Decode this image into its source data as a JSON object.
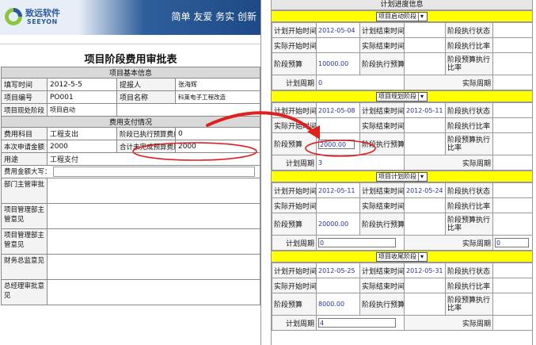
{
  "brand": {
    "name_cn": "致远软件",
    "name_en": "SEEYON",
    "slogan": "简单 友爱 务实 创新"
  },
  "form": {
    "title": "项目阶段费用审批表",
    "section_basic": "项目基本信息",
    "fill_time_label": "填写时间",
    "fill_time": "2012-5-5",
    "reporter_label": "提报人",
    "reporter": "张海辉",
    "project_no_label": "项目编号",
    "project_no": "PO001",
    "project_name_label": "项目名称",
    "project_name": "科莱电子工程改造",
    "current_stage_label": "项目现处阶段",
    "current_stage": "项目启动",
    "section_payment": "费用支付情况",
    "fee_subject_label": "费用科目",
    "fee_subject": "工程支出",
    "stage_executed_label": "阶段已执行预算费用",
    "stage_executed": "0",
    "apply_amount_label": "本次申请金额",
    "apply_amount": "2000",
    "total_unfinished_label": "合计未完成预算费用",
    "total_unfinished": "2000",
    "usage_label": "用途",
    "usage": "工程支付",
    "amount_caps_label": "费用金额大写：",
    "dept_opinion_label": "部门主管审批",
    "pm_opinion1_label": "项目管理部主管意见",
    "pm_opinion2_label": "项目管理部主管意见",
    "finance_opinion_label": "财务总监意见",
    "gm_opinion_label": "总经理审批意见"
  },
  "progress": {
    "title": "计划进度信息",
    "labels": {
      "plan_start": "计划开始时间",
      "plan_end": "计划结束时间",
      "stage_status": "阶段执行状态",
      "actual_start": "实际开始时间",
      "actual_end": "实际结束时间",
      "exec_rate": "阶段执行比率",
      "stage_budget": "阶段预算",
      "stage_exec_budget": "阶段执行预算",
      "budget_rate": "阶段预算执行比率",
      "plan_cycle": "计划周期",
      "actual_cycle": "实际周期"
    },
    "phases": [
      {
        "name": "项目启动阶段",
        "plan_start": "2012-05-04",
        "plan_end": "",
        "budget": "10000.00",
        "plan_cycle": "0"
      },
      {
        "name": "项目规划阶段",
        "plan_start": "2012-05-08",
        "plan_end": "2012-05-11",
        "budget": "2000.00",
        "plan_cycle": "3"
      },
      {
        "name": "项目计划阶段",
        "plan_start": "2012-05-11",
        "plan_end": "2012-05-24",
        "budget": "20000.00",
        "plan_cycle": "0",
        "actual_cycle": "0"
      },
      {
        "name": "项目收尾阶段",
        "plan_start": "2012-05-25",
        "plan_end": "2012-05-31",
        "budget": "8000.00",
        "plan_cycle": "4"
      }
    ]
  },
  "colors": {
    "highlight": "#ffff00",
    "annotation": "#e0201f",
    "value_blue": "#2233aa"
  }
}
